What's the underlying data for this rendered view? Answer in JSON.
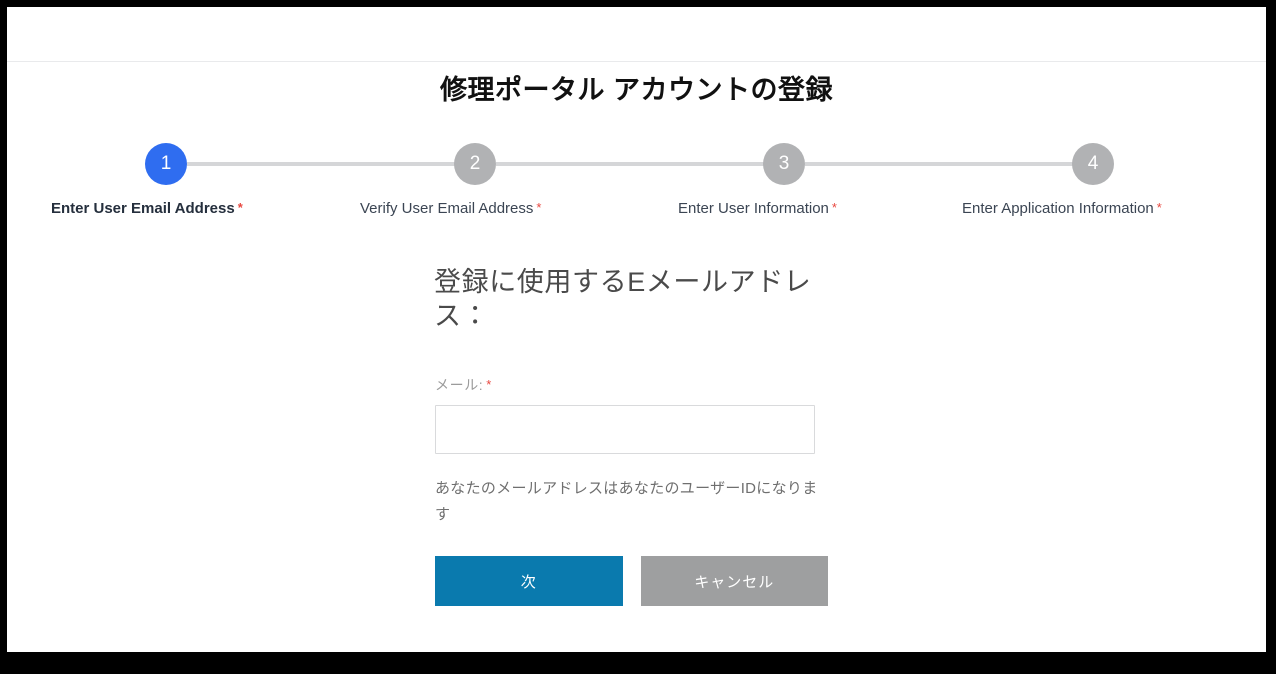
{
  "page": {
    "title": "修理ポータル アカウントの登録"
  },
  "stepper": {
    "required_marker": "*",
    "steps": [
      {
        "number": "1",
        "label": "Enter User Email Address",
        "required": true,
        "state": "active"
      },
      {
        "number": "2",
        "label": "Verify User Email Address",
        "required": true,
        "state": "inactive"
      },
      {
        "number": "3",
        "label": "Enter User Information",
        "required": true,
        "state": "inactive"
      },
      {
        "number": "4",
        "label": "Enter Application Information",
        "required": true,
        "state": "inactive"
      }
    ]
  },
  "form": {
    "heading": "登録に使用するEメールアドレス：",
    "email_label": "メール:",
    "email_required_marker": "*",
    "email_value": "",
    "email_placeholder": "",
    "help_text": "あなたのメールアドレスはあなたのユーザーIDになります",
    "next_label": "次",
    "cancel_label": "キャンセル"
  },
  "colors": {
    "active_step": "#2f6df0",
    "inactive_step": "#b1b2b4",
    "connector": "#d5d6d8",
    "required_star": "#e8473f",
    "primary_button": "#0a7aae",
    "secondary_button": "#9e9fa0",
    "frame": "#000000"
  }
}
